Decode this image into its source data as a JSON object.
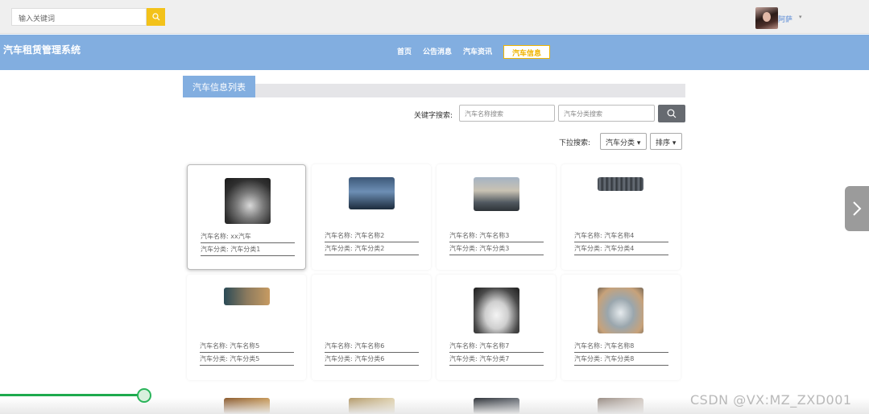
{
  "topbar": {
    "search_placeholder": "输入关键词",
    "username": "阿萨",
    "user_caret": "▾"
  },
  "navbar": {
    "site_title": "汽车租赁管理系统",
    "items": [
      {
        "label": "首页"
      },
      {
        "label": "公告消息"
      },
      {
        "label": "汽车资讯"
      },
      {
        "label": "汽车信息",
        "active": true
      }
    ]
  },
  "section": {
    "title": "汽车信息列表"
  },
  "filters": {
    "keyword_label": "关键字搜索:",
    "name_placeholder": "汽车名称搜索",
    "category_placeholder": "汽车分类搜索",
    "dropdown_label": "下拉搜索:",
    "category_dropdown": "汽车分类",
    "sort_dropdown": "排序"
  },
  "cards": [
    {
      "name_key": "汽车名称:",
      "name": "xx汽车",
      "cat_key": "汽车分类:",
      "category": "汽车分类1",
      "image": "car-dark-silver"
    },
    {
      "name_key": "汽车名称:",
      "name": "汽车名称2",
      "cat_key": "汽车分类:",
      "category": "汽车分类2",
      "image": "car-ad-banner"
    },
    {
      "name_key": "汽车名称:",
      "name": "汽车名称3",
      "cat_key": "汽车分类:",
      "category": "汽车分类3",
      "image": "car-street"
    },
    {
      "name_key": "汽车名称:",
      "name": "汽车名称4",
      "cat_key": "汽车分类:",
      "category": "汽车分类4",
      "image": "car-dark-strip"
    },
    {
      "name_key": "汽车名称:",
      "name": "汽车名称5",
      "cat_key": "汽车分类:",
      "category": "汽车分类5",
      "image": "car-sunset"
    },
    {
      "name_key": "汽车名称:",
      "name": "汽车名称6",
      "cat_key": "汽车分类:",
      "category": "汽车分类6",
      "image": "none"
    },
    {
      "name_key": "汽车名称:",
      "name": "汽车名称7",
      "cat_key": "汽车分类:",
      "category": "汽车分类7",
      "image": "car-white-suv"
    },
    {
      "name_key": "汽车名称:",
      "name": "汽车名称8",
      "cat_key": "汽车分类:",
      "category": "汽车分类8",
      "image": "car-silver-sport"
    }
  ],
  "video_progress": 0.166,
  "watermark": "CSDN @VX:MZ_ZXD001"
}
